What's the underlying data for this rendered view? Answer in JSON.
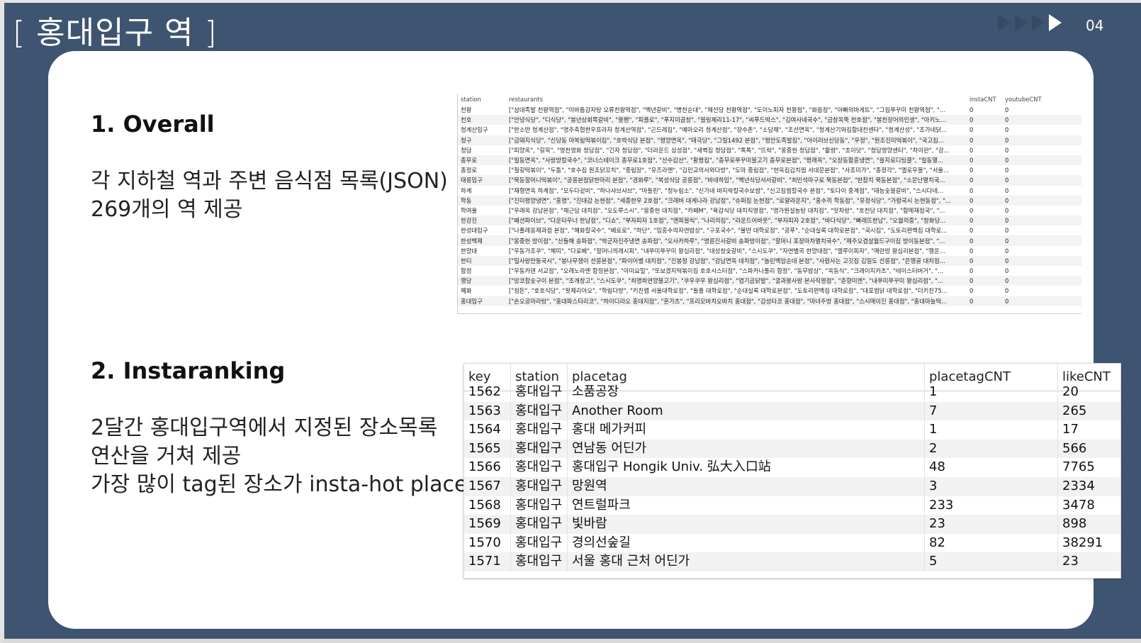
{
  "slide": {
    "title": "[ 홍대입구 역 ]",
    "page": "04"
  },
  "section1": {
    "heading": "1. Overall",
    "lines": [
      "각 지하철 역과 주변 음식점 목록(JSON)",
      "269개의 역 제공"
    ]
  },
  "section2": {
    "heading": "2. Instaranking",
    "lines": [
      "2달간 홍대입구역에서 지정된 장소목록",
      "연산을 거쳐 제공",
      "가장 많이 tag된 장소가 insta-hot place"
    ]
  },
  "overall_table": {
    "headers": [
      "station",
      "restaurants",
      "instaCNT",
      "youtubeCNT"
    ],
    "rows": [
      [
        "천왕",
        "[\"삼대족발 천왕역점\", \"이바돔감자탕 오류천왕역점\", \"백년갈비\", \"병천순대\", \"채선당 천왕역점\", \"도이노피자 천왕점\", \"화음정\", \"아빠의바게트\", \"그집쭈꾸미 천왕역점\", \"...",
        "0",
        "0"
      ],
      [
        "천호",
        "[\"안녕식당\", \"디식당\", \"봉년상회쪽갈비\", \"뭉펜\", \"피플로\", \"푸지미곱창\", \"블링체리11-17\", \"씨푸드박스\", \"김여사네국수\", \"금창옥뚝 천호점\", \"봉천장어의인생\", \"아키노...",
        "0",
        "0"
      ],
      [
        "청계산입구",
        "[\"한소반 청계산점\", \"명주축협한우프라자 청계산역점\", \"곤드레집\", \"예마오리 청계산점\", \"장수촌\", \"소담채\", \"조선면옥\", \"청계산기와집함대찬센타\", \"청계산성\", \"조가네닭...",
        "0",
        "0"
      ],
      [
        "청구",
        "[\"금돼지식당\", \"신당동 마복림떡볶이집\", \"호박식당 본점\", \"평양면옥\", \"태극당\", \"그릴1492 본점\", \"평안도족발집\", \"아이러브신당동\", \"우정\", \"원조진미떡볶이\", \"국고집...",
        "0",
        "0"
      ],
      [
        "청담",
        "[\"피양옥\", \"길목\", \"영천영화 청담점\", \"긴자 청담점\", \"더라운드 삼성점\", \"새벽집 청담점\", \"톡톡\", \"뜨락\", \"몽중헌 청담점\", \"활량\", \"초이닷\", \"청담영양센터\", \"차이란\", \"강...",
        "0",
        "0"
      ],
      [
        "총무로",
        "[\"필동면옥\", \"사랑방칼국수\", \"코너스테이크 총무로1호점\", \"산수갑산\", \"황평집\", \"충무로쭈꾸미불고기 충무로본점\", \"평래옥\", \"오장동함흥냉면\", \"을지로디팅클\", \"필동멸...",
        "0",
        "0"
      ],
      [
        "총정로",
        "[\"철길떡볶이\", \"두툼\", \"호수집 원조닭꼬치\", \"중림장\", \"유즈라멘\", \"김민교의사와다방\", \"도마 중림점\", \"한옥집김치찜 서대문본점\", \"사조미가\", \"총정각\", \"엘로우볼\", \"서울...",
        "0",
        "0"
      ],
      [
        "태릉입구",
        "[\"묵동할머니떡볶이\", \"공릉본점닭한마리 본점\", \"경화루\", \"복성식당 공릉점\", \"바네하임\", \"백년식당서서갈비\", \"최민석마구로 묵동본점\", \"한참치 묵동본점\", \"소문난멸치국...",
        "0",
        "0"
      ],
      [
        "하계",
        "[\"재형면옥 하계점\", \"모두다겉비\", \"하나샤브샤브\", \"마돌핀\", \"청누림소\", \"신가네 바지락칼국수보쌈\", \"신고집찜칼국수 본점\", \"토다이 중계점\", \"태능숯불갈비\", \"스시다네...",
        "0",
        "0"
      ],
      [
        "학동",
        "[\"진미평양냉면\", \"홍명\", \"진대감 논현점\", \"세종한우 2호점\", \"크래버 대게나라 강남점\", \"슈퍼집 논현점\", \"로얄라운지\", \"홍수끼 학동점\", \"유정식당\", \"가람국시 논현동점\", \"...",
        "0",
        "0"
      ],
      [
        "학여울",
        "[\"우래옥 강남본점\", \"채근담 대치점\", \"오도루스시\", \"몽중헌 대치점\", \"카페M\", \"육갑식당 대치직영점\", \"명가원설농탕 대치점\", \"맛차랑\", \"호천당 대치점\", \"함메재점국\", \"...",
        "0",
        "0"
      ],
      [
        "한강진",
        "[\"패션파이브\", \"다운타우너 한남점\", \"디쇼\", \"부자피자 1호점\", \"앤피블릭\", \"나리의집\", \"라운드어바웃\", \"부자피자 2호점\", \"바다식당\", \"빠레뜨한남\", \"오월의종\", \"창화당...",
        "0",
        "0"
      ],
      [
        "한성대입구",
        "[\"나폴레옹제과점 본점\", \"혜화칼국수\", \"베로로\", \"하단\", \"임흥수의자연밥상\", \"구포국수\", \"물반 대학로점\", \"공푸\", \"순대실록 대학로본점\", \"국시집\", \"도토리편백집 대학로...",
        "0",
        "0"
      ],
      [
        "한성백제",
        "[\"몽중헌 방이점\", \"산들해 송파점\", \"박군자진주냉면 송파점\", \"오사카하루\", \"명륜진사갈비 송파방이점\", \"할머니 포장마차멸치국수\", \"제주오겹살월드구이집 방이동본점\", \"...",
        "0",
        "0"
      ],
      [
        "한양대",
        "[\"우동가조쿠\", \"혜띠\", \"다로베\", \"할머니의레시피\", \"내쭈미쭈꾸미 왕십리점\", \"대성창숯갈비\", \"스시도쿠\", \"자연별곡 한양대점\", \"엘루이피자\", \"매란방 왕십리본점\", \"행운...",
        "0",
        "0"
      ],
      [
        "한티",
        "[\"밀사랑만둥국시\", \"봉나무쟁이 선릉본점\", \"파이어벨 대치점\", \"진봉정 강남점\", \"강남면옥 대치점\", \"놀린백암순대 본점\", \"사람사는 고깃집 김일도 선릉점\", \"은행골 대치점...",
        "0",
        "0"
      ],
      [
        "합정",
        "[\"우동카덴 서교점\", \"오레노라멘 합정본점\", \"아미요밀\", \"또보겠지떡볶이집 호호시스터점\", \"스파카나폴리 합정\", \"동무밥상\", \"옥동식\", \"크레이지카츠\", \"테이스터버거\", \"...",
        "0",
        "0"
      ],
      [
        "행당",
        "[\"망코참숯구이 본점\", \"조개창고\", \"스시도쿠\", \"최명희연양불고기\", \"쿠우쿠우 왕십리점\", \"엽기곰닭발\", \"굴과뭉사랑 본사직영점\", \"춘향미엔\", \"내쭈미쭈꾸미 왕십리점\", \"...",
        "0",
        "0"
      ],
      [
        "혜화",
        "[\"정돈\", \"호호식당\", \"핏제리아오\", \"학림다방\", \"키친랩 서울대학로점\", \"돌풀 대학로점\", \"순대실록 대학로본점\", \"도토리편백집 대학로점\", \"대포찜닭 대학로점\", \"더키친75...",
        "0",
        "0"
      ],
      [
        "홍대입구",
        "[\"손오공마라탕\", \"홍대파스타리코\", \"하이디라오 홍대지점\", \"혼가츠\", \"프리모바치오바치 홍대점\", \"감성타코 홍대점\", \"마녀주방 홍대점\", \"스시메이진 홍대점\", \"홍대마늘떡...",
        "0",
        "0"
      ]
    ]
  },
  "instaranking_table": {
    "headers": [
      "key",
      "station",
      "placetag",
      "placetagCNT",
      "likeCNT"
    ],
    "rows": [
      [
        "1562",
        "홍대입구",
        "소품공장",
        "1",
        "20"
      ],
      [
        "1563",
        "홍대입구",
        "Another Room",
        "7",
        "265"
      ],
      [
        "1564",
        "홍대입구",
        "홍대 메가커피",
        "1",
        "17"
      ],
      [
        "1565",
        "홍대입구",
        "연남동 어딘가",
        "2",
        "566"
      ],
      [
        "1566",
        "홍대입구",
        "홍대입구 Hongik Univ. 弘大入口站",
        "48",
        "7765"
      ],
      [
        "1567",
        "홍대입구",
        "망원역",
        "3",
        "2334"
      ],
      [
        "1568",
        "홍대입구",
        "연트럴파크",
        "233",
        "3478"
      ],
      [
        "1569",
        "홍대입구",
        "빛바람",
        "23",
        "898"
      ],
      [
        "1570",
        "홍대입구",
        "경의선숲길",
        "82",
        "38291"
      ],
      [
        "1571",
        "홍대입구",
        "서울 홍대 근처 어딘가",
        "5",
        "23"
      ]
    ]
  }
}
